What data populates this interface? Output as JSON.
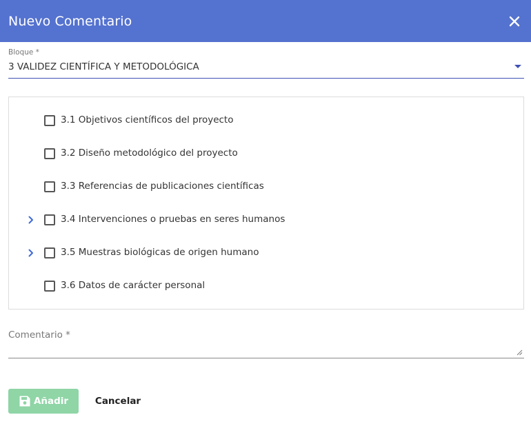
{
  "colors": {
    "accent": "#5472cf",
    "header_text": "#ffffff",
    "underline_active": "#3f51b5",
    "add_button_disabled": "#8fd5a6"
  },
  "dialog": {
    "title": "Nuevo Comentario",
    "close_icon": "close-icon"
  },
  "block_select": {
    "label": "Bloque *",
    "value": "3 VALIDEZ CIENTÍFICA Y METODOLÓGICA"
  },
  "tree": {
    "items": [
      {
        "label": "3.1 Objetivos científicos del proyecto",
        "expandable": false,
        "checked": false
      },
      {
        "label": "3.2 Diseño metodológico del proyecto",
        "expandable": false,
        "checked": false
      },
      {
        "label": "3.3 Referencias de publicaciones científicas",
        "expandable": false,
        "checked": false
      },
      {
        "label": "3.4 Intervenciones o pruebas en seres humanos",
        "expandable": true,
        "checked": false
      },
      {
        "label": "3.5 Muestras biológicas de origen humano",
        "expandable": true,
        "checked": false
      },
      {
        "label": "3.6 Datos de carácter personal",
        "expandable": false,
        "checked": false
      }
    ]
  },
  "comment": {
    "label": "Comentario *",
    "value": ""
  },
  "actions": {
    "add_label": "Añadir",
    "add_icon": "save-icon",
    "add_enabled": false,
    "cancel_label": "Cancelar"
  }
}
